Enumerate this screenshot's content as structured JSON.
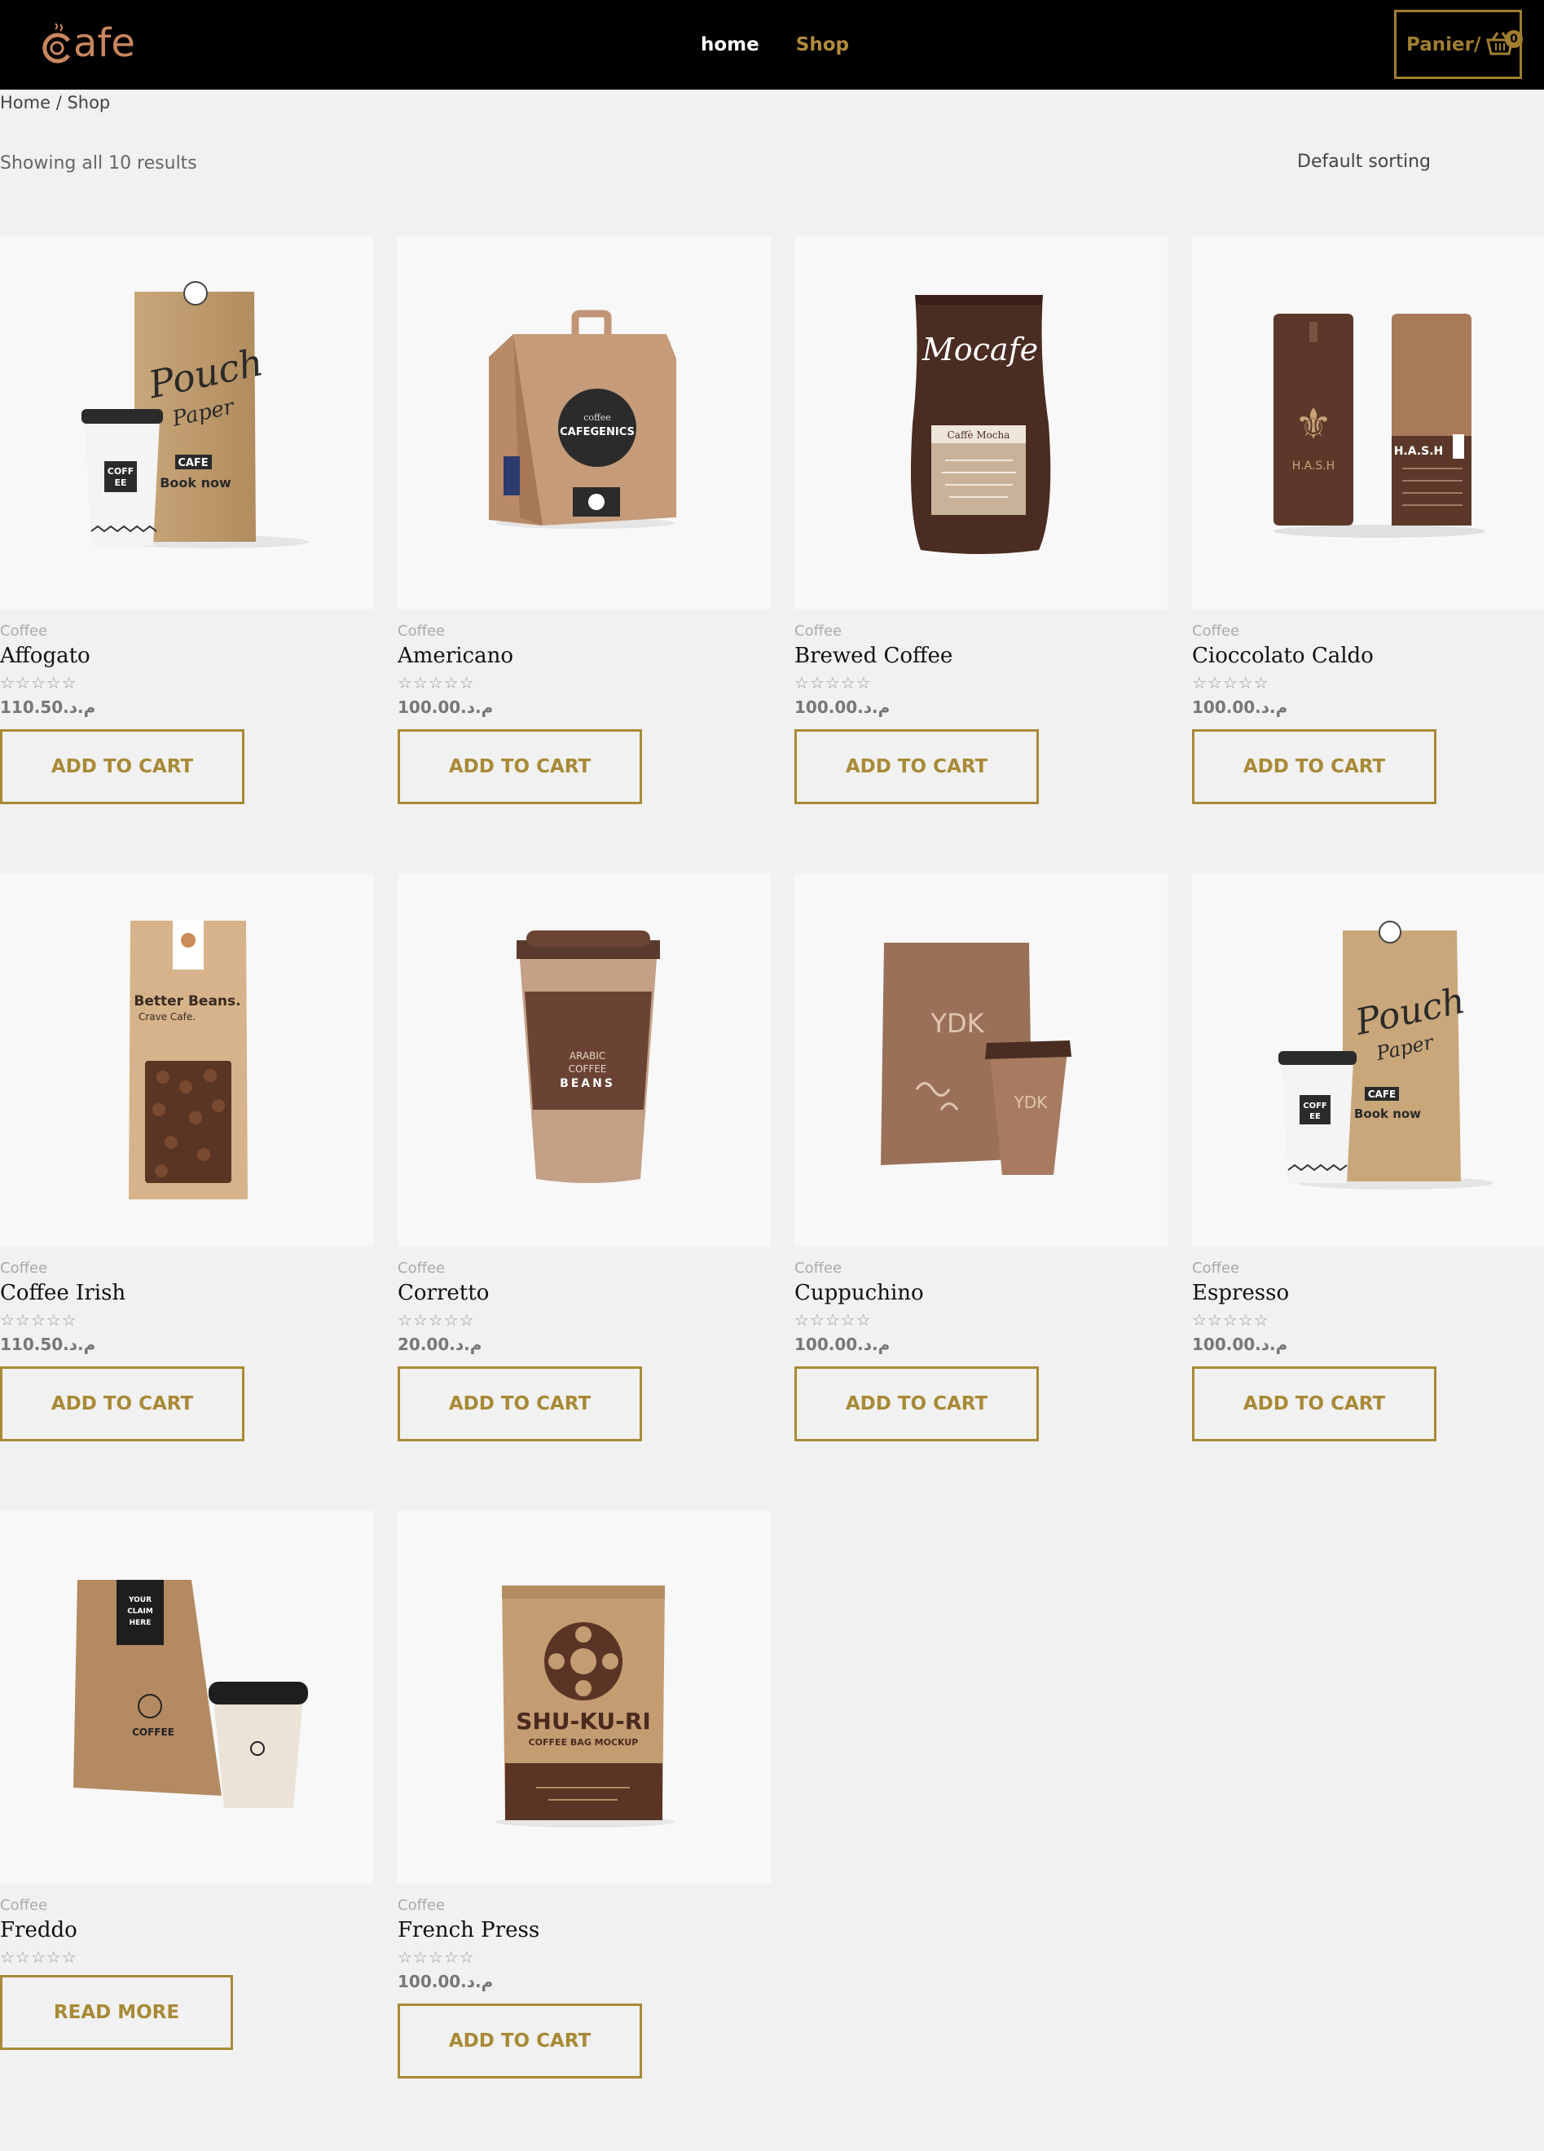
{
  "header": {
    "logo_text": "afe",
    "nav": [
      {
        "label": "home"
      },
      {
        "label": "Shop"
      }
    ],
    "cart_label": "Panier/",
    "cart_count": "0"
  },
  "breadcrumb": "Home / Shop",
  "result_count": "Showing all 10 results",
  "sorting": "Default sorting",
  "stars": "☆☆☆☆☆",
  "products": [
    {
      "category": "Coffee",
      "title": "Affogato",
      "price": "110.50.م.د",
      "button": "ADD TO CART"
    },
    {
      "category": "Coffee",
      "title": "Americano",
      "price": "100.00.م.د",
      "button": "ADD TO CART"
    },
    {
      "category": "Coffee",
      "title": "Brewed Coffee",
      "price": "100.00.م.د",
      "button": "ADD TO CART"
    },
    {
      "category": "Coffee",
      "title": "Cioccolato Caldo",
      "price": "100.00.م.د",
      "button": "ADD TO CART"
    },
    {
      "category": "Coffee",
      "title": "Coffee Irish",
      "price": "110.50.م.د",
      "button": "ADD TO CART"
    },
    {
      "category": "Coffee",
      "title": "Corretto",
      "price": "20.00.م.د",
      "button": "ADD TO CART"
    },
    {
      "category": "Coffee",
      "title": "Cuppuchino",
      "price": "100.00.م.د",
      "button": "ADD TO CART"
    },
    {
      "category": "Coffee",
      "title": "Espresso",
      "price": "100.00.م.د",
      "button": "ADD TO CART"
    },
    {
      "category": "Coffee",
      "title": "Freddo",
      "price": "",
      "button": "READ MORE"
    },
    {
      "category": "Coffee",
      "title": "French Press",
      "price": "100.00.م.د",
      "button": "ADD TO CART"
    }
  ],
  "image_text": {
    "pouch1": [
      "Pouch",
      "Paper",
      "CAFE",
      "Book now",
      "COFF",
      "EE"
    ],
    "americano": [
      "coffee",
      "CAFEGENICS"
    ],
    "mocafe": [
      "Mocafe",
      "Caffè Mocha"
    ],
    "hash": [
      "H.A.S.H",
      "H.A.S.H"
    ],
    "beans": [
      "Better Beans.",
      "Crave Cafe."
    ],
    "arabic": [
      "ARABIC",
      "COFFEE",
      "BEANS"
    ],
    "ydk": [
      "YDK",
      "YDK"
    ],
    "freddo": [
      "YOUR",
      "CLAIM",
      "HERE",
      "COFFEE"
    ],
    "shukuri": [
      "SHU-KU-RI",
      "COFFEE BAG MOCKUP"
    ]
  },
  "colors": {
    "gold": "#a88a36",
    "header_bg": "#000000",
    "page_bg": "#f1f1f1",
    "logo": "#c8875e"
  }
}
